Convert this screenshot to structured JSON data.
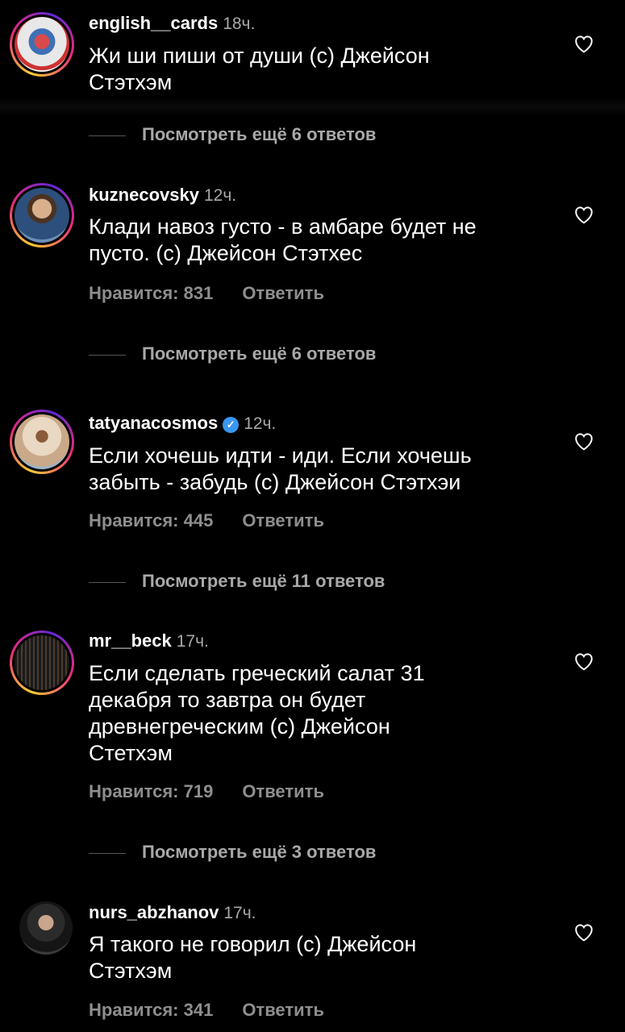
{
  "comments": [
    {
      "username": "english__cards",
      "time": "18ч.",
      "text": "Жи ши пиши от души (с) Джейсон Стэтхэм",
      "likes": "",
      "reply": "",
      "more": "Посмотреть ещё 6 ответов",
      "verified": false
    },
    {
      "username": "kuznecovsky",
      "time": "12ч.",
      "text": "Клади навоз густо - в амбаре будет не пусто. (с) Джейсон Стэтхес",
      "likes": "Нравится: 831",
      "reply": "Ответить",
      "more": "Посмотреть ещё 6 ответов",
      "verified": false
    },
    {
      "username": "tatyanacosmos",
      "time": "12ч.",
      "text": "Если хочешь идти - иди. Если хочешь забыть - забудь (с) Джейсон Стэтхэи",
      "likes": "Нравится: 445",
      "reply": "Ответить",
      "more": "Посмотреть ещё 11 ответов",
      "verified": true
    },
    {
      "username": "mr__beck",
      "time": "17ч.",
      "text": "Если сделать греческий салат 31 декабря то завтра он будет древнегреческим (с) Джейсон Стетхэм",
      "likes": "Нравится: 719",
      "reply": "Ответить",
      "more": "Посмотреть ещё 3 ответов",
      "verified": false
    },
    {
      "username": "nurs_abzhanov",
      "time": "17ч.",
      "text": "Я такого не говорил (с) Джейсон Стэтхэм",
      "likes": "Нравится: 341",
      "reply": "Ответить",
      "more": "",
      "verified": false
    }
  ],
  "icons": {
    "heart": "heart-outline-icon",
    "verified": "verified-badge-icon"
  },
  "colors": {
    "background": "#000000",
    "secondary_text": "#8e8e8e",
    "verified": "#3897f0"
  }
}
